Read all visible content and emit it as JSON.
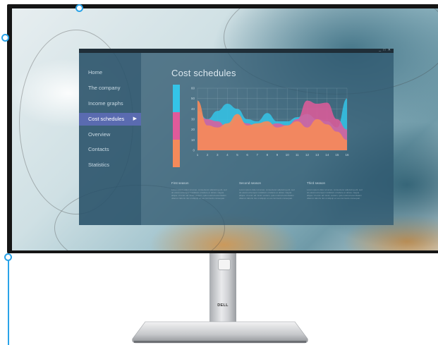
{
  "brand": {
    "logo_text": "DELL"
  },
  "app": {
    "window_controls": "_ □ ✕",
    "title": "Cost schedules",
    "nav": [
      {
        "label": "Home"
      },
      {
        "label": "The company"
      },
      {
        "label": "Income graphs"
      },
      {
        "label": "Cost schedules",
        "active": true
      },
      {
        "label": "Overview"
      },
      {
        "label": "Contacts"
      },
      {
        "label": "Statistics"
      }
    ],
    "columns": [
      {
        "heading": "First season",
        "body": "Lorem ipsum dolor sit amet, consectetur adipiscing elit, sed do eiusmod tempor incididunt ut labore et dolore magna aliqua. Ut enim ad minim veniam, quis nostrud exercitation ullamco laboris nisi ut aliquip ex ea commodo consequat."
      },
      {
        "heading": "Second season",
        "body": "Lorem ipsum dolor sit amet, consectetur adipiscing elit, sed do eiusmod tempor incididunt ut labore et dolore magna aliqua. Ut enim ad minim veniam, quis nostrud exercitation ullamco laboris nisi ut aliquip ex ea commodo consequat."
      },
      {
        "heading": "Third season",
        "body": "Lorem ipsum dolor sit amet, consectetur adipiscing elit, sed do eiusmod tempor incididunt ut labore et dolore magna aliqua. Ut enim ad minim veniam, quis nostrud exercitation ullamco laboris nisi ut aliquip ex ea commodo consequat."
      }
    ]
  },
  "chart_data": {
    "type": "area",
    "x": [
      1,
      2,
      3,
      4,
      5,
      6,
      7,
      8,
      9,
      10,
      11,
      12,
      13,
      14,
      15,
      16
    ],
    "ylim": [
      0,
      60
    ],
    "yticks": [
      0,
      10,
      20,
      30,
      40,
      50,
      60
    ],
    "grid": true,
    "series": [
      {
        "color": "#34c4e8",
        "values": [
          38,
          30,
          38,
          45,
          40,
          30,
          28,
          36,
          28,
          28,
          32,
          35,
          30,
          28,
          22,
          50
        ]
      },
      {
        "color": "#e05a9a",
        "values": [
          35,
          30,
          28,
          22,
          30,
          26,
          22,
          24,
          26,
          24,
          30,
          48,
          45,
          46,
          30,
          20
        ]
      },
      {
        "color": "#f58a5a",
        "values": [
          48,
          24,
          22,
          26,
          35,
          24,
          26,
          28,
          22,
          24,
          28,
          22,
          30,
          25,
          18,
          10
        ]
      }
    ],
    "legend_colors": [
      "#34c4e8",
      "#e05a9a",
      "#f58a5a"
    ]
  },
  "colors": {
    "accent": "#5a6bb0",
    "callout": "#2aa3e8"
  }
}
